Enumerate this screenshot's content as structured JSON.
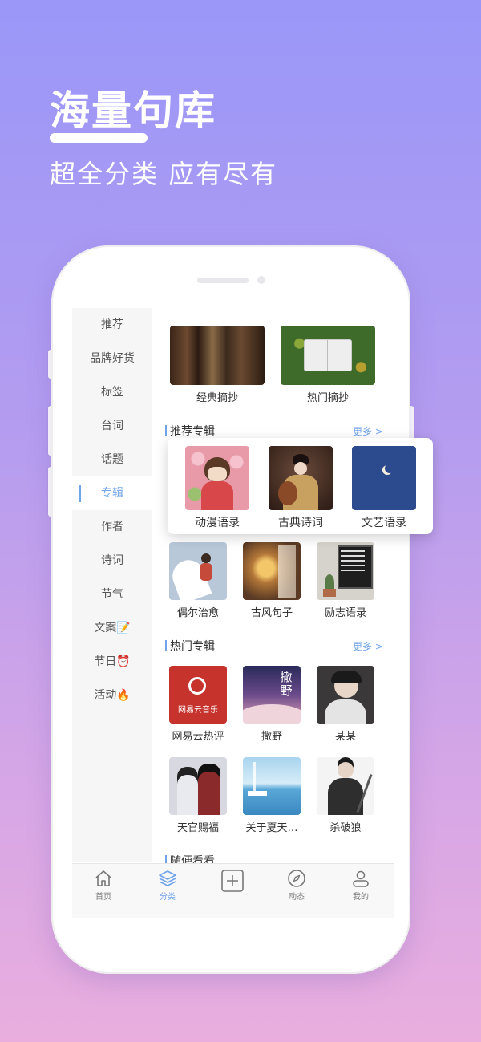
{
  "promo": {
    "headline": "海量句库",
    "subline": "超全分类  应有尽有"
  },
  "sidebar": {
    "items": [
      {
        "label": "推荐"
      },
      {
        "label": "品牌好货"
      },
      {
        "label": "标签"
      },
      {
        "label": "台词"
      },
      {
        "label": "话题"
      },
      {
        "label": "专辑",
        "active": true
      },
      {
        "label": "作者"
      },
      {
        "label": "诗词"
      },
      {
        "label": "节气"
      },
      {
        "label": "文案",
        "emoji": "📝"
      },
      {
        "label": "节日",
        "emoji": "⏰"
      },
      {
        "label": "活动",
        "emoji": "🔥"
      }
    ]
  },
  "top_cards": [
    {
      "label": "经典摘抄",
      "icon": "books-photo"
    },
    {
      "label": "热门摘抄",
      "icon": "open-book-photo"
    }
  ],
  "recommended": {
    "title": "推荐专辑",
    "more": "更多 >",
    "popup_cards": [
      {
        "label": "动漫语录",
        "icon": "anime-girl-photo"
      },
      {
        "label": "古典诗词",
        "icon": "classical-lady-photo"
      },
      {
        "label": "文艺语录",
        "icon": "moon-photo"
      }
    ],
    "cards": [
      {
        "label": "偶尔治愈",
        "icon": "hug-illustration"
      },
      {
        "label": "古风句子",
        "icon": "lantern-photo"
      },
      {
        "label": "励志语录",
        "icon": "letter-board-photo"
      }
    ]
  },
  "hot": {
    "title": "热门专辑",
    "more": "更多 >",
    "cards": [
      {
        "label": "网易云热评",
        "icon": "netease-music-logo",
        "logo_text": "网易云音乐"
      },
      {
        "label": "撒野",
        "icon": "starry-sky-illustration",
        "art_text": "撒野"
      },
      {
        "label": "某某",
        "icon": "boy-portrait-illustration"
      },
      {
        "label": "天官赐福",
        "icon": "couple-illustration"
      },
      {
        "label": "关于夏天…",
        "icon": "summer-sea-illustration"
      },
      {
        "label": "杀破狼",
        "icon": "swordsman-illustration"
      }
    ]
  },
  "random": {
    "title": "随便看看"
  },
  "tabbar": {
    "items": [
      {
        "label": "首页",
        "icon": "home-icon"
      },
      {
        "label": "分类",
        "icon": "layers-icon",
        "active": true
      },
      {
        "label": "",
        "icon": "plus-square-icon"
      },
      {
        "label": "动态",
        "icon": "compass-icon"
      },
      {
        "label": "我的",
        "icon": "user-icon"
      }
    ]
  },
  "colors": {
    "accent": "#6fa3ea",
    "bg_top": "#9a97f8",
    "bg_bottom": "#e9aede"
  }
}
